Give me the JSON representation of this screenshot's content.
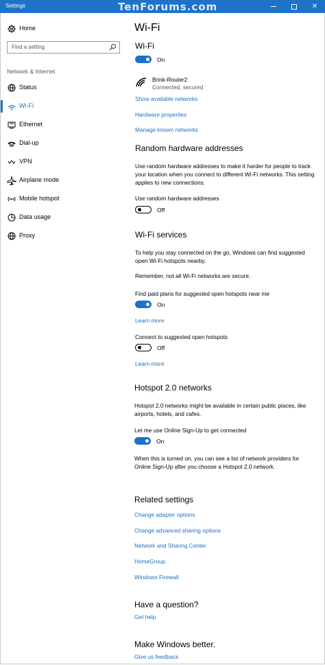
{
  "window": {
    "title": "Settings",
    "watermark": "TenForums.com"
  },
  "sidebar": {
    "home": "Home",
    "search_placeholder": "Find a setting",
    "section": "Network & Internet",
    "items": [
      {
        "label": "Status",
        "icon": "globe-icon"
      },
      {
        "label": "Wi-Fi",
        "icon": "wifi-icon",
        "selected": true
      },
      {
        "label": "Ethernet",
        "icon": "ethernet-icon"
      },
      {
        "label": "Dial-up",
        "icon": "dialup-icon"
      },
      {
        "label": "VPN",
        "icon": "vpn-icon"
      },
      {
        "label": "Airplane mode",
        "icon": "airplane-icon"
      },
      {
        "label": "Mobile hotspot",
        "icon": "hotspot-icon"
      },
      {
        "label": "Data usage",
        "icon": "data-usage-icon"
      },
      {
        "label": "Proxy",
        "icon": "globe-icon"
      }
    ]
  },
  "main": {
    "page_title": "Wi-Fi",
    "wifi": {
      "heading": "Wi-Fi",
      "toggle": "On",
      "network_name": "Brink-Router2",
      "network_status": "Connected, secured",
      "links": [
        "Show available networks",
        "Hardware properties",
        "Manage known networks"
      ]
    },
    "random": {
      "heading": "Random hardware addresses",
      "description": "Use random hardware addresses to make it harder for people to track your location when you connect to different Wi-Fi networks. This setting applies to new connections.",
      "label": "Use random hardware addresses",
      "toggle": "Off"
    },
    "services": {
      "heading": "Wi-Fi services",
      "description": "To help you stay connected on the go, Windows can find suggested open Wi-Fi hotspots nearby.",
      "note": "Remember, not all Wi-Fi networks are secure.",
      "paid_label": "Find paid plans for suggested open hotspots near me",
      "paid_toggle": "On",
      "learn1": "Learn more",
      "connect_label": "Connect to suggested open hotspots",
      "connect_toggle": "Off",
      "learn2": "Learn more"
    },
    "hotspot": {
      "heading": "Hotspot 2.0 networks",
      "description": "Hotspot 2.0 networks might be available in certain public places, like airports, hotels, and cafes.",
      "label": "Let me use Online Sign-Up to get connected",
      "toggle": "On",
      "note": "When this is turned on, you can see a list of network providers for Online Sign-Up after you choose a Hotspot 2.0 network."
    },
    "related": {
      "heading": "Related settings",
      "links": [
        "Change adapter options",
        "Change advanced sharing options",
        "Network and Sharing Center",
        "HomeGroup",
        "Windows Firewall"
      ]
    },
    "question": {
      "heading": "Have a question?",
      "link": "Get help"
    },
    "better": {
      "heading": "Make Windows better.",
      "link": "Give us feedback"
    }
  },
  "colors": {
    "accent": "#1a73c8",
    "titlebar": "#1e73c8",
    "link": "#1a6fc4"
  }
}
